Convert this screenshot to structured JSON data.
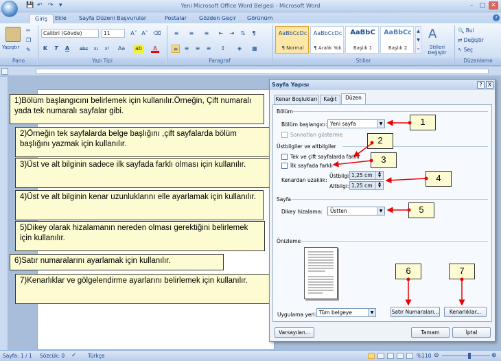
{
  "window": {
    "title": "Yeni Microsoft Office Word Belgesi - Microsoft Word"
  },
  "tabs": [
    "Giriş",
    "Ekle",
    "Sayfa Düzeni",
    "Başvurular",
    "Postalar",
    "Gözden Geçir",
    "Görünüm"
  ],
  "ribbon": {
    "clipboard": {
      "paste_label": "Yapıştır",
      "group_label": "Pano"
    },
    "font": {
      "font_name": "Calibri (Gövde)",
      "font_size": "11",
      "group_label": "Yazı Tipi"
    },
    "paragraph": {
      "group_label": "Paragraf"
    },
    "styles": {
      "items": [
        {
          "preview": "AaBbCcDc",
          "name": "¶ Normal"
        },
        {
          "preview": "AaBbCcDc",
          "name": "¶ Aralık Yok"
        },
        {
          "preview": "AaBbC",
          "name": "Başlık 1"
        },
        {
          "preview": "AaBbCc",
          "name": "Başlık 2"
        }
      ],
      "change_styles": "Stilleri Değiştir",
      "group_label": "Stiller"
    },
    "editing": {
      "find": "Bul",
      "replace": "Değiştir",
      "select": "Seç",
      "group_label": "Düzenleme"
    }
  },
  "notes": [
    "1)Bölüm başlangıcını belirlemek için kullanılır.Örneğin, Çift numaralı yada tek numaralı sayfalar gibi.",
    "2)Örneğin tek sayfalarda belge başlığını ,çift sayfalarda bölüm başlığını yazmak için kullanılır.",
    "3)Üst ve alt bilginin sadece ilk sayfada farklı olması için kullanılır.",
    "4)Üst ve alt bilginin kenar uzunluklarını elle ayarlamak için kullanılır.",
    "5)Dikey olarak hizalamanın nereden olması gerektiğini belirlemek için kullanılır.",
    "6)Satır numaralarını ayarlamak için kullanılır.",
    "7)Kenarlıklar ve gölgelendirme ayarlarını belirlemek için kullanılır."
  ],
  "dialog": {
    "title": "Sayfa Yapısı",
    "help": "?",
    "close": "X",
    "tabs": [
      "Kenar Boşlukları",
      "Kağıt",
      "Düzen"
    ],
    "section_label": "Bölüm",
    "section_start_label": "Bölüm başlangıcı:",
    "section_start_value": "Yeni sayfa",
    "suppress_endnotes": "Sonnotları gösterme",
    "headers_label": "Üstbilgiler ve altbilgiler",
    "odd_even": "Tek ve çift sayfalarda farklı",
    "first_page": "İlk sayfada farklı",
    "from_edge_label": "Kenardan uzaklık:",
    "header_label": "Üstbilgi:",
    "header_value": "1,25 cm",
    "footer_label": "Altbilgi:",
    "footer_value": "1,25 cm",
    "page_label": "Sayfa",
    "valign_label": "Dikey hizalama:",
    "valign_value": "Üstten",
    "preview_label": "Önizleme",
    "apply_label": "Uygulama yeri:",
    "apply_value": "Tüm belgeye",
    "line_numbers": "Satır Numaraları...",
    "borders": "Kenarlıklar...",
    "default": "Varsayılan...",
    "ok": "Tamam",
    "cancel": "İptal"
  },
  "markers": [
    "1",
    "2",
    "3",
    "4",
    "5",
    "6",
    "7"
  ],
  "status": {
    "page": "Sayfa: 1 / 1",
    "words": "Sözcük: 0",
    "language": "Türkçe",
    "zoom": "%110"
  }
}
